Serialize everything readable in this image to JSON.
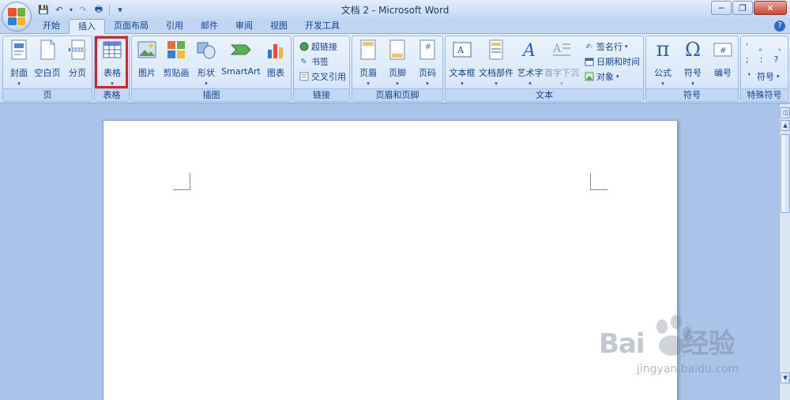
{
  "window": {
    "title": "文档 2 - Microsoft Word",
    "minimize": "─",
    "restore": "❐",
    "close": "✕"
  },
  "qat": {
    "save_icon": "💾",
    "undo_icon": "↶",
    "redo_icon": "↷",
    "customize_icon": "▾"
  },
  "tabs": [
    "开始",
    "插入",
    "页面布局",
    "引用",
    "邮件",
    "审阅",
    "视图",
    "开发工具"
  ],
  "active_tab": "插入",
  "groups": {
    "pages": {
      "label": "页",
      "cover": "封面",
      "blank": "空白页",
      "break": "分页"
    },
    "tables": {
      "label": "表格",
      "table": "表格"
    },
    "illustrations": {
      "label": "插图",
      "picture": "图片",
      "clipart": "剪贴画",
      "shapes": "形状",
      "smartart": "SmartArt",
      "chart": "图表"
    },
    "links": {
      "label": "链接",
      "hyperlink": "超链接",
      "bookmark": "书签",
      "crossref": "交叉引用"
    },
    "header_footer": {
      "label": "页眉和页脚",
      "header": "页眉",
      "footer": "页脚",
      "page_number": "页码"
    },
    "text": {
      "label": "文本",
      "textbox": "文本框",
      "quickparts": "文档部件",
      "wordart": "艺术字",
      "dropcap": "首字下沉",
      "signature": "签名行",
      "datetime": "日期和时间",
      "object": "对象"
    },
    "symbols": {
      "label": "符号",
      "equation": "公式",
      "symbol": "符号",
      "number": "编号",
      "pi": "π",
      "omega": "Ω"
    },
    "special": {
      "label": "特殊符号",
      "symbol": "符号",
      "chars": [
        "'",
        "。",
        "、",
        ";",
        ":",
        "?"
      ]
    }
  },
  "watermark": {
    "brand": "Bai",
    "brand2": "经验",
    "site": "jingyan.baidu.com"
  },
  "colors": {
    "highlight": "#d8232a",
    "ribbon": "#dbe8f9",
    "workspace": "#a9c4e8"
  }
}
